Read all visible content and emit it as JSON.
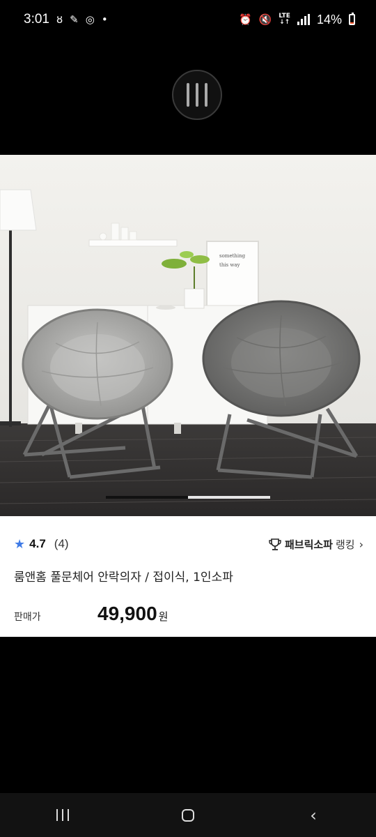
{
  "status_bar": {
    "time": "3:01",
    "network": "LTE",
    "battery": "14%",
    "battery_level": 0.14,
    "icons": [
      "kakao-icon",
      "notification-app-icon",
      "chrome-icon",
      "dot-icon",
      "alarm-icon",
      "mute-icon",
      "lte-icon",
      "signal-icon",
      "battery-icon"
    ]
  },
  "viewer": {
    "menu_icon": "vertical-bars-icon",
    "carousel_position": 0.5
  },
  "photo": {
    "poster_text_line1": "something",
    "poster_text_line2": "this way"
  },
  "product": {
    "rating": "4.7",
    "review_count": "(4)",
    "ranking_category": "패브릭소파",
    "ranking_suffix": "랭킹",
    "title": "룸앤홈 풀문체어 안락의자 / 접이식, 1인소파",
    "price_label": "판매가",
    "price": "49,900",
    "price_unit": "원"
  },
  "colors": {
    "star": "#3f7be6",
    "battery_low": "#ff5a2e"
  },
  "nav": {
    "icons": [
      "recents-icon",
      "home-icon",
      "back-icon"
    ]
  }
}
